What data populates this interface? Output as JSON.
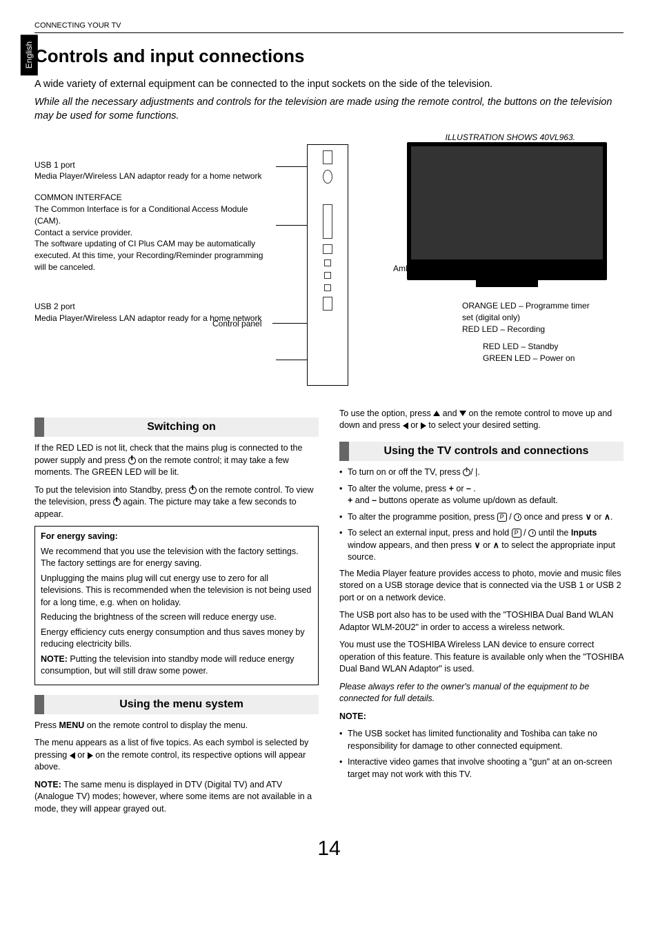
{
  "sideTab": "English",
  "headerSection": "CONNECTING YOUR TV",
  "pageTitle": "Controls and input connections",
  "intro": {
    "p1": "A wide variety of external equipment can be connected to the input sockets on the side of the television.",
    "p2": "While all the necessary adjustments and controls for the television are made using the remote control, the buttons on the television may be used for some functions."
  },
  "diagram": {
    "caption": "ILLUSTRATION SHOWS  40VL963.",
    "usb1": {
      "title": "USB 1 port",
      "desc": "Media Player/Wireless LAN adaptor ready for a home network"
    },
    "commonInterface": {
      "title": "COMMON INTERFACE",
      "l1": "The Common Interface is for a Conditional Access Module (CAM).",
      "l2": "Contact a service provider.",
      "l3": "The software updating of CI Plus CAM may be automatically executed. At this time, your Recording/Reminder programming will be canceled."
    },
    "controlPanel": "Control panel",
    "usb2": {
      "title": "USB 2 port",
      "desc": "Media Player/Wireless LAN adaptor ready for a home network"
    },
    "ambientLight": "Ambient Light Sensor",
    "orangeLed": "ORANGE LED – Programme timer set (digital only)",
    "redLedRec": "RED LED – Recording",
    "redLedStandby": "RED LED – Standby",
    "greenLed": "GREEN LED – Power on"
  },
  "switching": {
    "heading": "Switching on",
    "p1a": "If the RED LED is not lit, check that the mains plug is connected to the power supply and press ",
    "p1b": " on the remote control; it may take a few moments. The GREEN LED will be lit.",
    "p2a": "To put the television into Standby, press ",
    "p2b": " on the remote control. To view the television, press ",
    "p2c": " again. The picture may take a few seconds to appear.",
    "box": {
      "title": "For energy saving:",
      "p1": "We recommend that you use the television with the factory settings. The factory settings are for energy saving.",
      "p2": "Unplugging the mains plug will cut energy use to zero for all televisions. This is recommended when the television is not being used for a long time, e.g. when on holiday.",
      "p3": "Reducing the brightness of the screen will reduce energy use.",
      "p4": "Energy efficiency cuts energy consumption and thus saves money by reducing electricity bills.",
      "noteLabel": "NOTE:",
      "note": " Putting the television into standby mode will reduce energy consumption, but will still draw some power."
    }
  },
  "menuSystem": {
    "heading": "Using the menu system",
    "p1a": "Press ",
    "p1Menu": "MENU",
    "p1b": " on the remote control to display the menu.",
    "p2a": "The menu appears as a list of five topics. As each symbol is selected by pressing ",
    "p2or": " or ",
    "p2b": " on the remote control, its respective options will appear above.",
    "noteLabel": "NOTE:",
    "note": " The same menu is displayed in DTV (Digital TV) and ATV (Analogue TV) modes; however, where some items are not available in a mode, they will appear grayed out."
  },
  "rightCol": {
    "topP_a": "To use the option, press ",
    "topP_and": " and ",
    "topP_b": " on the remote control to move up and down and press ",
    "topP_or": " or ",
    "topP_c": " to select your desired setting.",
    "heading": "Using the TV controls and connections",
    "li1a": "To turn on or off the TV, press ",
    "li1b": "/ |.",
    "li2a": "To alter the volume, press ",
    "li2plus": "+",
    "li2or": " or ",
    "li2minus": "–",
    "li2dot": " .",
    "li2b_a": "+",
    "li2b_and": " and ",
    "li2b_b": "–",
    "li2b_c": " buttons operate as volume up/down as default.",
    "li3a": "To alter the programme position, press ",
    "li3b": " once and press ",
    "li3or": " or ",
    "li3c": ".",
    "li4a": "To select an external input, press and hold ",
    "li4b": " until the ",
    "li4inputs": "Inputs",
    "li4c": " window appears, and then press ",
    "li4or": " or ",
    "li4d": " to select the appropriate input source.",
    "p1": "The Media Player feature provides access to photo, movie and music files stored on a USB storage device that is connected via the USB 1 or USB 2 port or on a network device.",
    "p2": "The USB port also has to be used with the \"TOSHIBA Dual Band WLAN Adaptor WLM-20U2\" in order to access a wireless network.",
    "p3": "You must use the TOSHIBA Wireless LAN device to ensure correct operation of this feature. This feature is available only when the \"TOSHIBA Dual Band WLAN Adaptor\" is used.",
    "p4": "Please always refer to the owner's manual of the equipment to be connected for full details.",
    "noteLabel": "NOTE:",
    "noteLi1": "The USB socket has limited functionality and Toshiba can take no responsibility for damage to other connected equipment.",
    "noteLi2": "Interactive video games that involve shooting a \"gun\" at an on-screen target may not work with this TV."
  },
  "pageNumber": "14"
}
